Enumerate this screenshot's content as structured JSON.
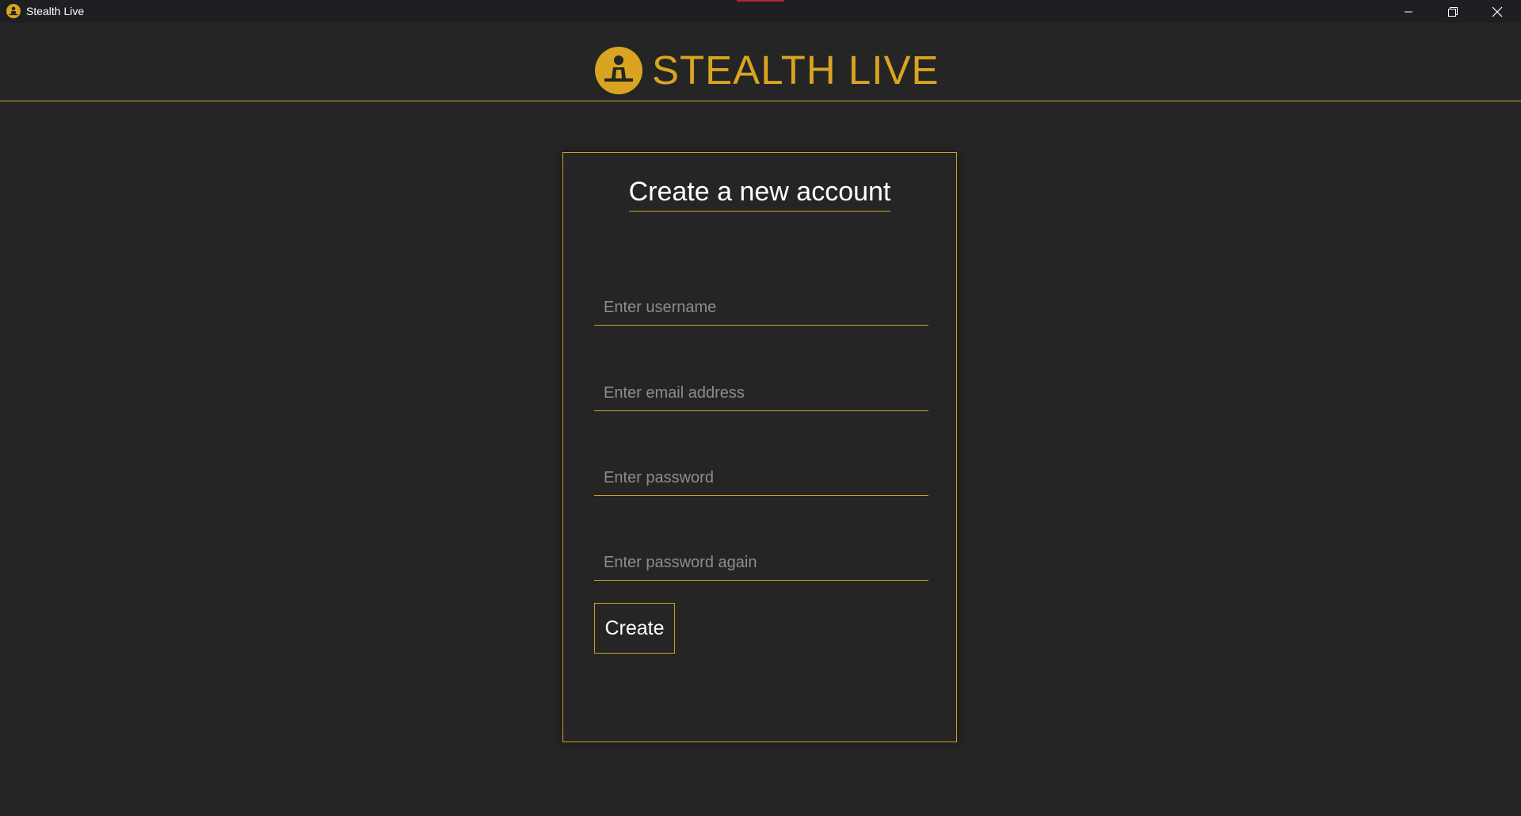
{
  "window": {
    "title": "Stealth Live",
    "controls": {
      "minimize_icon": "minimize-icon",
      "maximize_icon": "restore-icon",
      "close_icon": "close-icon"
    }
  },
  "header": {
    "brand_name": "STEALTH LIVE",
    "logo_icon": "person-at-desk-logo-icon"
  },
  "form": {
    "title": "Create a new account",
    "fields": [
      {
        "name": "username",
        "placeholder": "Enter username",
        "value": ""
      },
      {
        "name": "email",
        "placeholder": "Enter email address",
        "value": ""
      },
      {
        "name": "password",
        "placeholder": "Enter password",
        "value": ""
      },
      {
        "name": "password_confirm",
        "placeholder": "Enter password again",
        "value": ""
      }
    ],
    "submit_label": "Create"
  },
  "colors": {
    "accent": "#d9a521",
    "border_accent": "#c9a227",
    "background": "#252525",
    "titlebar": "#1e1f22",
    "text": "#ffffff",
    "placeholder": "#8d8d8d"
  }
}
